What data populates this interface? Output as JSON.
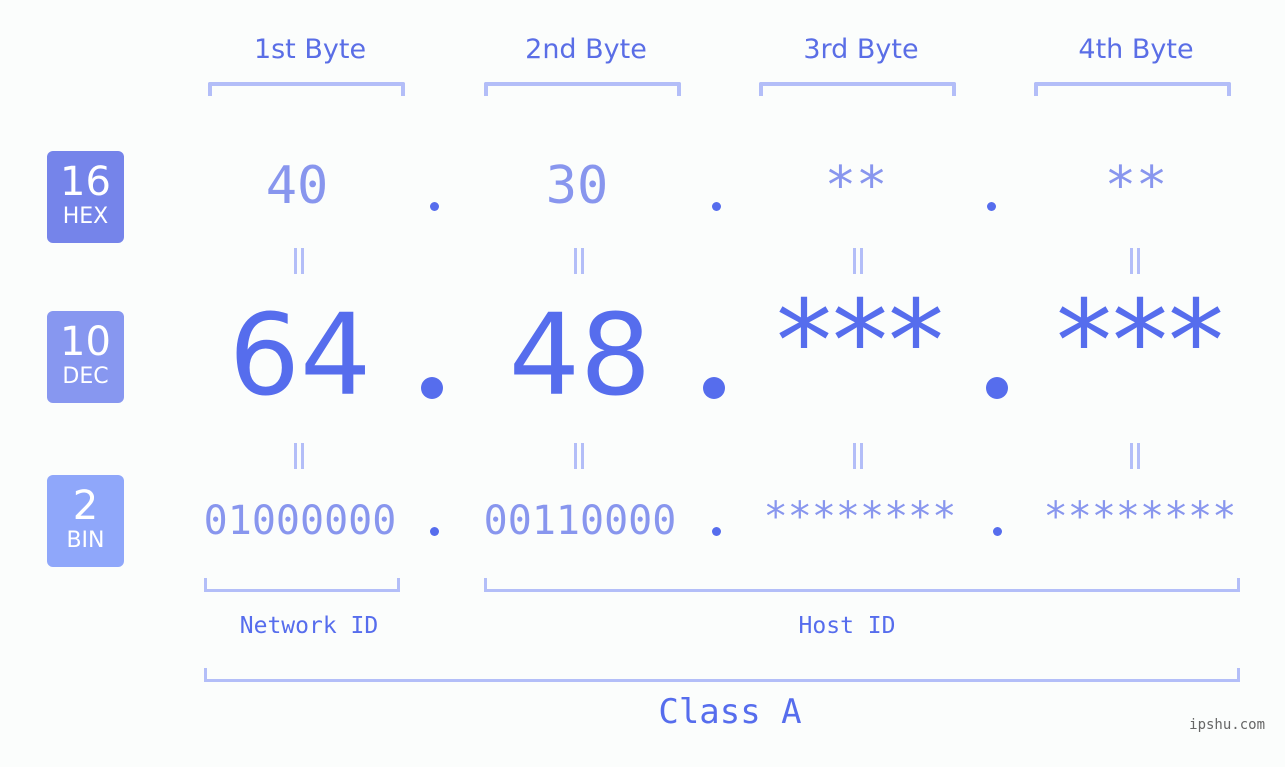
{
  "bytes": {
    "headers": [
      "1st Byte",
      "2nd Byte",
      "3rd Byte",
      "4th Byte"
    ]
  },
  "bases": {
    "hex": {
      "number": "16",
      "label": "HEX",
      "color": "#7584ea"
    },
    "dec": {
      "number": "10",
      "label": "DEC",
      "color": "#8797f0"
    },
    "bin": {
      "number": "2",
      "label": "BIN",
      "color": "#8fa7fa"
    }
  },
  "rows": {
    "hex": [
      "40",
      "30",
      "**",
      "**"
    ],
    "dec": [
      "64",
      "48",
      "***",
      "***"
    ],
    "bin": [
      "01000000",
      "00110000",
      "********",
      "********"
    ]
  },
  "separator": ".",
  "parts": {
    "network_id": "Network ID",
    "host_id": "Host ID",
    "class": "Class A"
  },
  "watermark": "ipshu.com",
  "colors": {
    "accent": "#566ded",
    "light_value": "#8896ee",
    "bracket": "#b3bef8",
    "background": "#fbfdfc"
  }
}
